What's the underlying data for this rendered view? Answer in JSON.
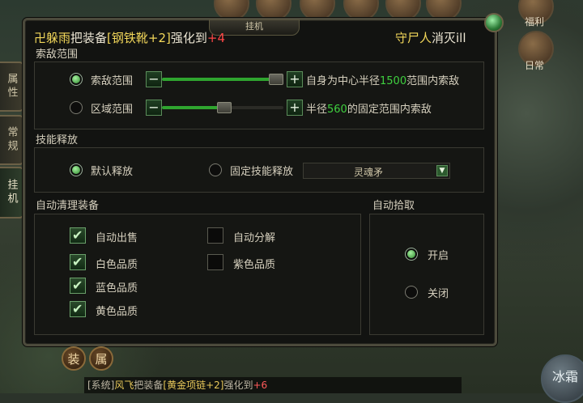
{
  "hud": {
    "fuli_label": "福利",
    "richang_label": "日常"
  },
  "tabs": [
    {
      "label": "属性"
    },
    {
      "label": "常规"
    },
    {
      "label": "挂机"
    }
  ],
  "panel": {
    "title": "挂机",
    "marquee": {
      "name": "卍躲雨",
      "text1": "把装备",
      "item": "[钢铁靴+2]",
      "text2": "强化到",
      "level": "+4",
      "right_name": "守尸人",
      "right_text": "消灭ill"
    },
    "search": {
      "title": "索敌范围",
      "row1": {
        "label": "索敌范围",
        "desc_pre": "自身为中心半径",
        "value": "1500",
        "desc_post": "范围内索敌",
        "level": 0.9
      },
      "row2": {
        "label": "区域范围",
        "desc_pre": "半径",
        "value": "560",
        "desc_post": "的固定范围内索敌",
        "level": 0.45
      }
    },
    "skill": {
      "title": "技能释放",
      "default_label": "默认释放",
      "fixed_label": "固定技能释放",
      "selected_skill": "灵魂矛"
    },
    "cleanup": {
      "title": "自动清理装备",
      "items": [
        {
          "label": "自动出售",
          "checked": true
        },
        {
          "label": "自动分解",
          "checked": false
        },
        {
          "label": "白色品质",
          "checked": true
        },
        {
          "label": "紫色品质",
          "checked": false
        },
        {
          "label": "蓝色品质",
          "checked": true
        },
        {
          "label": "黄色品质",
          "checked": true
        }
      ]
    },
    "pickup": {
      "title": "自动拾取",
      "on_label": "开启",
      "off_label": "关闭"
    }
  },
  "bottom": {
    "btn1": "装",
    "btn2": "属",
    "skill_label": "冰霜"
  },
  "chat": {
    "prefix": "[系统]",
    "name": "风飞",
    "text1": "把装备",
    "item": "[黄金项链+2]",
    "text2": "强化到",
    "level": "+6"
  }
}
